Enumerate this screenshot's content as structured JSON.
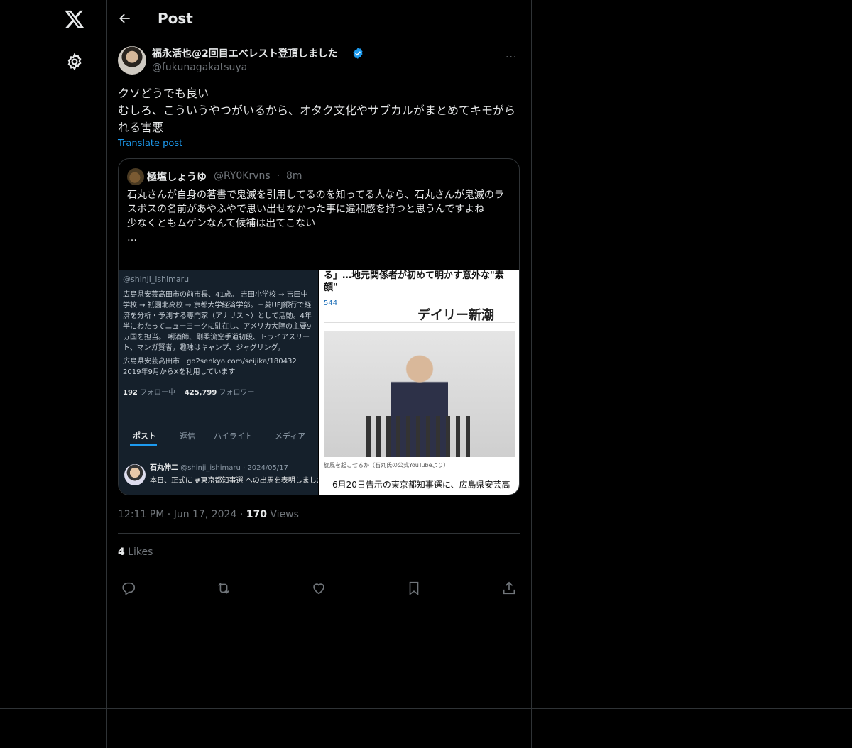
{
  "nav": {
    "logo_icon": "x-logo-icon",
    "settings_icon": "gear-icon"
  },
  "header": {
    "title": "Post",
    "back_icon": "arrow-left-icon"
  },
  "post": {
    "author_name": "福永活也@2回目エベレスト登頂しました",
    "author_handle": "@fukunagakatsuya",
    "verified_icon": "verified-badge-icon",
    "more_icon": "···",
    "text_lines": [
      "クソどうでも良い",
      "むしろ、こういうやつがいるから、オタク文化やサブカルがまとめてキモがられる害悪"
    ],
    "translate_label": "Translate post",
    "time": "12:11 PM",
    "date": "Jun 17, 2024",
    "views_count": "170",
    "views_label": "Views",
    "likes_count": "4",
    "likes_label": "Likes"
  },
  "quote": {
    "author_name": "極塩しょうゆ",
    "author_handle": "@RY0Krvns",
    "time": "8m",
    "text_lines": [
      "石丸さんが自身の著書で鬼滅を引用してるのを知ってる人なら、石丸さんが鬼滅のラスボスの名前があやふやで思い出せなかった事に違和感を持つと思うんですよね",
      "少なくともムゲンなんて候補は出てこない",
      "…"
    ],
    "image_left": {
      "handle": "@shinji_ishimaru",
      "bio_lines": [
        "広島県安芸高田市の前市長、41歳。 吉田小学校 → 吉田中学校 → 祇園北高校 → 京都大学経済学部。三菱UFJ銀行で経済を分析・予測する専門家（アナリスト）として活動。4年半にわたってニューヨークに駐在し、アメリカ大陸の主要9ヵ国を担当。 唎酒師、剛柔流空手道初段、トライアスリート、マンガ賢者。趣味はキャンプ、ジャグリング。",
        "広島県安芸高田市　go2senkyo.com/seijika/180432",
        "2019年9月からXを利用しています"
      ],
      "following_count": "192",
      "following_label": "フォロー中",
      "followers_count": "425,799",
      "followers_label": "フォロワー",
      "tabs": [
        "ポスト",
        "返信",
        "ハイライト",
        "メディア"
      ],
      "pinned_name": "石丸伸二",
      "pinned_handle": "@shinji_ishimaru · 2024/05/17",
      "pinned_text": "本日、正式に #東京都知事選 への出馬を表明しました。"
    },
    "image_right": {
      "headline": "る」…地元関係者が初めて明かす意外な\"素顔\"",
      "comment_count": "544",
      "brand": "デイリー新潮",
      "caption": "旋風を起こせるか（石丸氏の公式YouTubeより）",
      "body": "6月20日告示の東京都知事選に、広島県安芸高"
    }
  },
  "actions": {
    "reply_icon": "reply-icon",
    "repost_icon": "repost-icon",
    "like_icon": "heart-icon",
    "bookmark_icon": "bookmark-icon",
    "share_icon": "share-icon"
  },
  "colors": {
    "background": "#000000",
    "text": "#e7e9ea",
    "muted": "#71767b",
    "accent": "#1d9bf0",
    "border": "#2f3336"
  }
}
